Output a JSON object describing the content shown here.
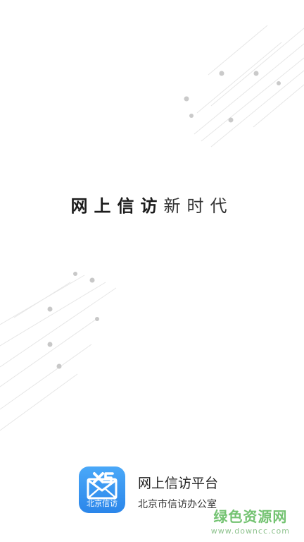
{
  "slogan": {
    "bold": "网上信访",
    "light": "新时代"
  },
  "app": {
    "icon_label": "北京信访",
    "title": "网上信访平台",
    "subtitle": "北京市信访办公室"
  },
  "watermark": {
    "main": "绿色资源网",
    "url": "www.downcc.com"
  },
  "colors": {
    "icon_blue": "#3a9af2",
    "watermark_green": "#65bd63",
    "decor_line": "#e3e3e3",
    "decor_dot": "#c8c8c8"
  }
}
